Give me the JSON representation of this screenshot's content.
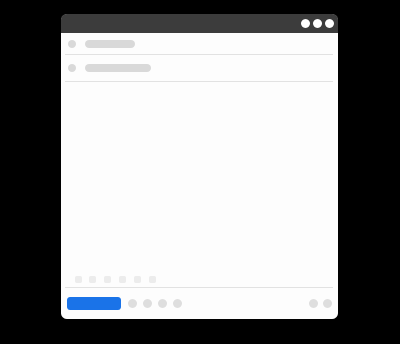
{
  "window": {
    "controls": [
      "minimize-dot",
      "maximize-dot",
      "close-dot"
    ]
  },
  "compose": {
    "fields": [
      {
        "name": "recipients",
        "icon": "person-icon",
        "value": ""
      },
      {
        "name": "subject",
        "icon": "tag-icon",
        "value": ""
      }
    ],
    "body": "",
    "formatting_icons": [
      "undo-icon",
      "redo-icon",
      "font-icon",
      "bold-icon",
      "italic-icon",
      "link-icon"
    ],
    "send_label": "",
    "action_icons": [
      "attach-icon",
      "link-icon",
      "photo-icon",
      "emoji-icon"
    ],
    "right_icons": [
      "more-icon",
      "trash-icon"
    ]
  },
  "colors": {
    "accent": "#1a73e8",
    "titlebar": "#3c3c3c",
    "background": "#000000",
    "surface": "#fdfdfd"
  }
}
